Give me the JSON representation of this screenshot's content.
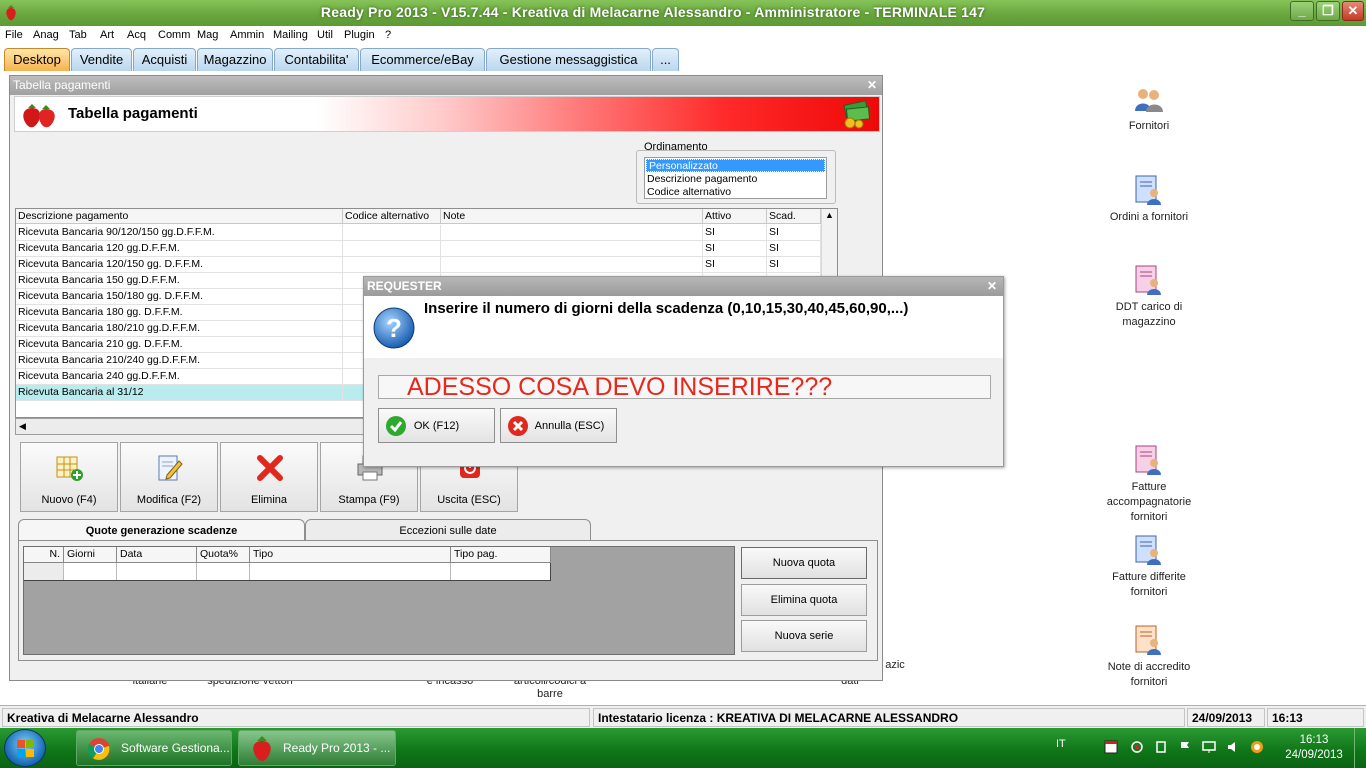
{
  "window": {
    "title": "Ready Pro 2013 - V15.7.44 - Kreativa di Melacarne Alessandro - Amministratore - TERMINALE 147",
    "controls": [
      "_",
      "❐",
      "✕"
    ]
  },
  "menu": [
    "File",
    "Anag",
    "Tab",
    "Art",
    "Acq",
    "Comm",
    "Mag",
    "Ammin",
    "Mailing",
    "Util",
    "Plugin",
    "?"
  ],
  "tabs": [
    "Desktop",
    "Vendite",
    "Acquisti",
    "Magazzino",
    "Contabilita'",
    "Ecommerce/eBay",
    "Gestione messaggistica",
    "..."
  ],
  "tabella": {
    "window_title": "Tabella pagamenti",
    "header_title": "Tabella pagamenti",
    "close": "✕",
    "ordinamento": {
      "label": "Ordinamento",
      "options": [
        "Personalizzato",
        "Descrizione pagamento",
        "Codice alternativo"
      ],
      "selected": "Personalizzato"
    },
    "columns": [
      "Descrizione pagamento",
      "Codice alternativo",
      "Note",
      "Attivo",
      "Scad."
    ],
    "rows": [
      {
        "desc": "Ricevuta Bancaria 90/120/150 gg.D.F.F.M.",
        "alt": "",
        "note": "",
        "attivo": "SI",
        "scad": "SI"
      },
      {
        "desc": "Ricevuta Bancaria 120 gg.D.F.F.M.",
        "alt": "",
        "note": "",
        "attivo": "SI",
        "scad": "SI"
      },
      {
        "desc": "Ricevuta Bancaria 120/150 gg. D.F.F.M.",
        "alt": "",
        "note": "",
        "attivo": "SI",
        "scad": "SI"
      },
      {
        "desc": "Ricevuta Bancaria 150 gg.D.F.F.M.",
        "alt": "",
        "note": "",
        "attivo": "",
        "scad": ""
      },
      {
        "desc": "Ricevuta Bancaria 150/180 gg. D.F.F.M.",
        "alt": "",
        "note": "",
        "attivo": "",
        "scad": ""
      },
      {
        "desc": "Ricevuta Bancaria 180 gg. D.F.F.M.",
        "alt": "",
        "note": "",
        "attivo": "",
        "scad": ""
      },
      {
        "desc": "Ricevuta Bancaria 180/210 gg.D.F.F.M.",
        "alt": "",
        "note": "",
        "attivo": "",
        "scad": ""
      },
      {
        "desc": "Ricevuta Bancaria 210 gg. D.F.F.M.",
        "alt": "",
        "note": "",
        "attivo": "",
        "scad": ""
      },
      {
        "desc": "Ricevuta Bancaria 210/240 gg.D.F.F.M.",
        "alt": "",
        "note": "",
        "attivo": "",
        "scad": ""
      },
      {
        "desc": "Ricevuta Bancaria 240 gg.D.F.F.M.",
        "alt": "",
        "note": "",
        "attivo": "",
        "scad": ""
      },
      {
        "desc": "Ricevuta Bancaria al 31/12",
        "alt": "",
        "note": "",
        "attivo": "",
        "scad": ""
      }
    ],
    "selected_row": 10,
    "buttons": [
      "Nuovo (F4)",
      "Modifica (F2)",
      "Elimina",
      "Stampa (F9)",
      "Uscita (ESC)"
    ],
    "subtabs": [
      "Quote generazione scadenze",
      "Eccezioni sulle date"
    ],
    "subgrid_columns": [
      "N.",
      "Giorni",
      "Data",
      "Quota%",
      "Tipo",
      "Tipo pag."
    ],
    "quote_buttons": [
      "Nuova quota",
      "Elimina quota",
      "Nuova serie"
    ]
  },
  "requester": {
    "title": "REQUESTER",
    "close": "✕",
    "message": "Inserire il numero di giorni della scadenza (0,10,15,30,40,45,60,90,...)",
    "input_value": "ADESSO COSA DEVO INSERIRE???",
    "ok": "OK (F12)",
    "cancel": "Annulla (ESC)"
  },
  "desktop_icons": [
    {
      "label": "Fornitori",
      "icon": "people-icon"
    },
    {
      "label": "Ordini a fornitori",
      "icon": "document-people-icon"
    },
    {
      "label": "DDT carico di magazzino",
      "icon": "document-people-icon"
    },
    {
      "label": "Fatture accompagnatorie fornitori",
      "icon": "document-people-icon"
    },
    {
      "label": "Fatture differite fornitori",
      "icon": "document-people-icon"
    },
    {
      "label": "Note di accredito fornitori",
      "icon": "document-people-icon"
    }
  ],
  "hidden_desktop_labels": [
    "italiane",
    "spedizione vettori",
    "e incasso",
    "articoli/codici a barre",
    "azic",
    "dati"
  ],
  "statusbar": {
    "company": "Kreativa di Melacarne Alessandro",
    "license": "Intestatario licenza : KREATIVA DI MELACARNE ALESSANDRO",
    "date": "24/09/2013",
    "time": "16:13"
  },
  "taskbar": {
    "items": [
      "Software Gestiona...",
      "Ready Pro 2013 - ..."
    ],
    "language": "IT",
    "clock_time": "16:13",
    "clock_date": "24/09/2013"
  },
  "colors": {
    "accent_green": "#6aa63e",
    "selected_row": "#b8ecee",
    "input_text": "#e8281c"
  }
}
